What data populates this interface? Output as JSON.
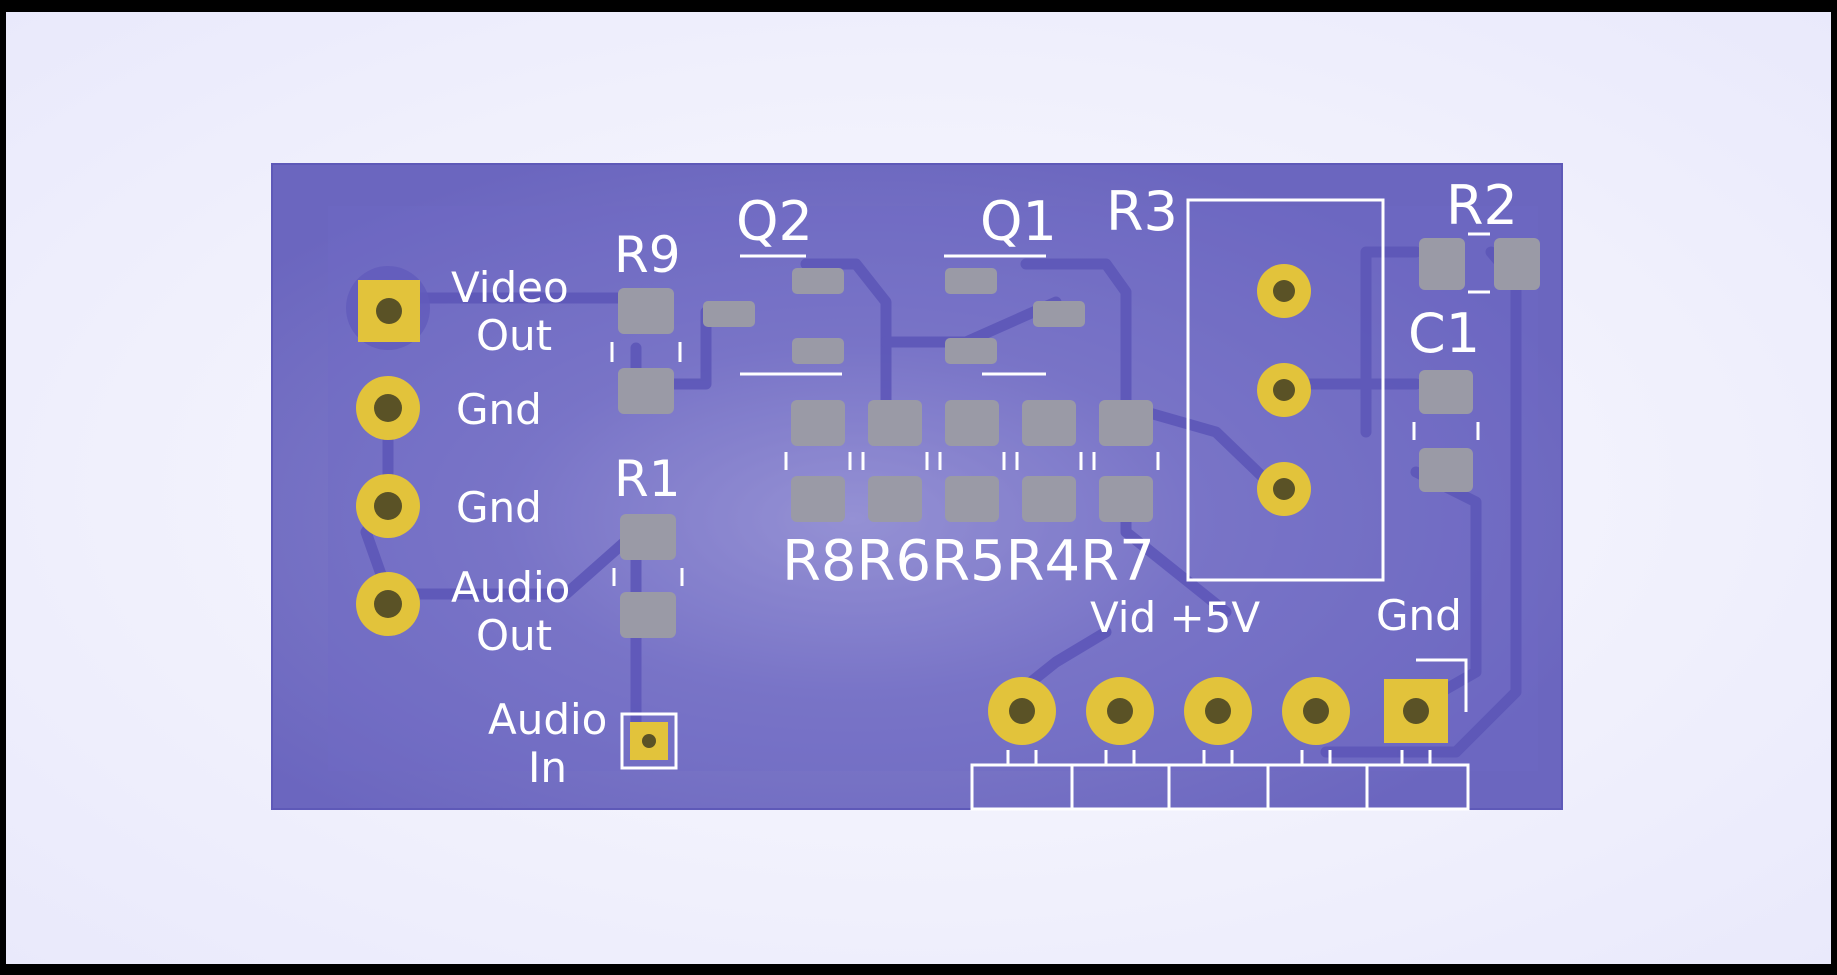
{
  "board": {
    "colors": {
      "substrate": "#6d68c4",
      "copper": "#5f59bc",
      "silkscreen": "#ffffff",
      "pad_gold": "#e2c33b",
      "pad_hole": "#5a5226",
      "smd_pad": "#9a9aa6",
      "background": "#efeffb"
    },
    "labels": {
      "video_out_1": "Video",
      "video_out_2": "Out",
      "gnd_a": "Gnd",
      "gnd_b": "Gnd",
      "audio_out_1": "Audio",
      "audio_out_2": "Out",
      "audio_in_1": "Audio",
      "audio_in_2": "In",
      "r9": "R9",
      "r1": "R1",
      "q2": "Q2",
      "q1": "Q1",
      "r3": "R3",
      "r2": "R2",
      "c1": "C1",
      "resistor_row": "R8R6R5R4R7",
      "header_vid_5v": "Vid +5V",
      "header_gnd": "Gnd"
    }
  }
}
